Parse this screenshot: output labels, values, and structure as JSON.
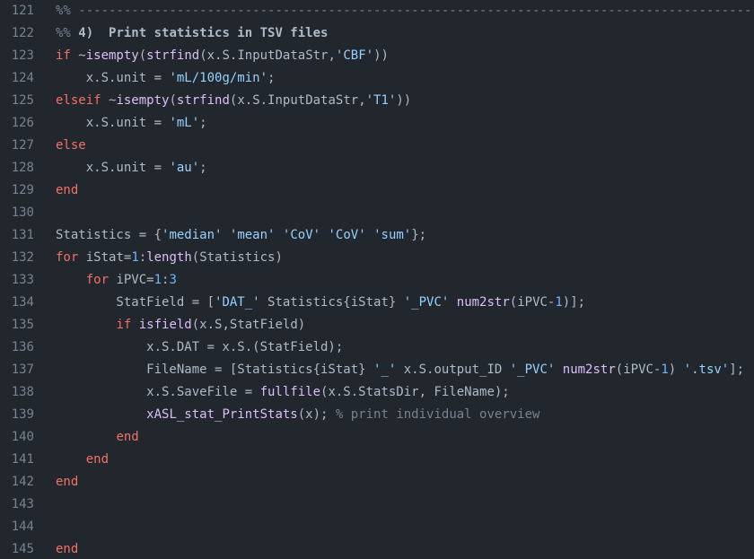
{
  "editor": {
    "lines": [
      {
        "num": "121",
        "tokens": [
          {
            "t": "%% --------------------------------------------------------------------------------------------",
            "c": "com"
          }
        ]
      },
      {
        "num": "122",
        "tokens": [
          {
            "t": "%% ",
            "c": "com"
          },
          {
            "t": "4)  Print statistics in TSV files",
            "c": "hdr"
          }
        ]
      },
      {
        "num": "123",
        "tokens": [
          {
            "t": "if",
            "c": "kw"
          },
          {
            "t": " ~",
            "c": "var"
          },
          {
            "t": "isempty",
            "c": "fn"
          },
          {
            "t": "(",
            "c": "var"
          },
          {
            "t": "strfind",
            "c": "fn"
          },
          {
            "t": "(x.S.InputDataStr,",
            "c": "var"
          },
          {
            "t": "'CBF'",
            "c": "str"
          },
          {
            "t": "))",
            "c": "var"
          }
        ]
      },
      {
        "num": "124",
        "tokens": [
          {
            "t": "    x.S.unit = ",
            "c": "var"
          },
          {
            "t": "'mL/100g/min'",
            "c": "str"
          },
          {
            "t": ";",
            "c": "var"
          }
        ]
      },
      {
        "num": "125",
        "tokens": [
          {
            "t": "elseif",
            "c": "kw"
          },
          {
            "t": " ~",
            "c": "var"
          },
          {
            "t": "isempty",
            "c": "fn"
          },
          {
            "t": "(",
            "c": "var"
          },
          {
            "t": "strfind",
            "c": "fn"
          },
          {
            "t": "(x.S.InputDataStr,",
            "c": "var"
          },
          {
            "t": "'T1'",
            "c": "str"
          },
          {
            "t": "))",
            "c": "var"
          }
        ]
      },
      {
        "num": "126",
        "tokens": [
          {
            "t": "    x.S.unit = ",
            "c": "var"
          },
          {
            "t": "'mL'",
            "c": "str"
          },
          {
            "t": ";",
            "c": "var"
          }
        ]
      },
      {
        "num": "127",
        "tokens": [
          {
            "t": "else",
            "c": "kw"
          }
        ]
      },
      {
        "num": "128",
        "tokens": [
          {
            "t": "    x.S.unit = ",
            "c": "var"
          },
          {
            "t": "'au'",
            "c": "str"
          },
          {
            "t": ";",
            "c": "var"
          }
        ]
      },
      {
        "num": "129",
        "tokens": [
          {
            "t": "end",
            "c": "kw"
          }
        ]
      },
      {
        "num": "130",
        "tokens": []
      },
      {
        "num": "131",
        "tokens": [
          {
            "t": "Statistics = {",
            "c": "var"
          },
          {
            "t": "'median'",
            "c": "str"
          },
          {
            "t": " ",
            "c": "var"
          },
          {
            "t": "'mean'",
            "c": "str"
          },
          {
            "t": " ",
            "c": "var"
          },
          {
            "t": "'CoV'",
            "c": "str"
          },
          {
            "t": " ",
            "c": "var"
          },
          {
            "t": "'CoV'",
            "c": "str"
          },
          {
            "t": " ",
            "c": "var"
          },
          {
            "t": "'sum'",
            "c": "str"
          },
          {
            "t": "};",
            "c": "var"
          }
        ]
      },
      {
        "num": "132",
        "tokens": [
          {
            "t": "for",
            "c": "kw"
          },
          {
            "t": " iStat=",
            "c": "var"
          },
          {
            "t": "1",
            "c": "num"
          },
          {
            "t": ":",
            "c": "var"
          },
          {
            "t": "length",
            "c": "fn"
          },
          {
            "t": "(Statistics)",
            "c": "var"
          }
        ]
      },
      {
        "num": "133",
        "tokens": [
          {
            "t": "    ",
            "c": "var"
          },
          {
            "t": "for",
            "c": "kw"
          },
          {
            "t": " iPVC=",
            "c": "var"
          },
          {
            "t": "1",
            "c": "num"
          },
          {
            "t": ":",
            "c": "var"
          },
          {
            "t": "3",
            "c": "num"
          }
        ]
      },
      {
        "num": "134",
        "tokens": [
          {
            "t": "        StatField = [",
            "c": "var"
          },
          {
            "t": "'DAT_'",
            "c": "str"
          },
          {
            "t": " Statistics{iStat} ",
            "c": "var"
          },
          {
            "t": "'_PVC'",
            "c": "str"
          },
          {
            "t": " ",
            "c": "var"
          },
          {
            "t": "num2str",
            "c": "fn"
          },
          {
            "t": "(iPVC-",
            "c": "var"
          },
          {
            "t": "1",
            "c": "num"
          },
          {
            "t": ")];",
            "c": "var"
          }
        ]
      },
      {
        "num": "135",
        "tokens": [
          {
            "t": "        ",
            "c": "var"
          },
          {
            "t": "if",
            "c": "kw"
          },
          {
            "t": " ",
            "c": "var"
          },
          {
            "t": "isfield",
            "c": "fn"
          },
          {
            "t": "(x.S,StatField)",
            "c": "var"
          }
        ]
      },
      {
        "num": "136",
        "tokens": [
          {
            "t": "            x.S.DAT = x.S.(StatField);",
            "c": "var"
          }
        ]
      },
      {
        "num": "137",
        "tokens": [
          {
            "t": "            FileName = [Statistics{iStat} ",
            "c": "var"
          },
          {
            "t": "'_'",
            "c": "str"
          },
          {
            "t": " x.S.output_ID ",
            "c": "var"
          },
          {
            "t": "'_PVC'",
            "c": "str"
          },
          {
            "t": " ",
            "c": "var"
          },
          {
            "t": "num2str",
            "c": "fn"
          },
          {
            "t": "(iPVC-",
            "c": "var"
          },
          {
            "t": "1",
            "c": "num"
          },
          {
            "t": ") ",
            "c": "var"
          },
          {
            "t": "'.tsv'",
            "c": "str"
          },
          {
            "t": "];",
            "c": "var"
          }
        ]
      },
      {
        "num": "138",
        "tokens": [
          {
            "t": "            x.S.SaveFile = ",
            "c": "var"
          },
          {
            "t": "fullfile",
            "c": "fn"
          },
          {
            "t": "(x.S.StatsDir, FileName);",
            "c": "var"
          }
        ]
      },
      {
        "num": "139",
        "tokens": [
          {
            "t": "            ",
            "c": "var"
          },
          {
            "t": "xASL_stat_PrintStats",
            "c": "fn"
          },
          {
            "t": "(x); ",
            "c": "var"
          },
          {
            "t": "% print individual overview",
            "c": "com"
          }
        ]
      },
      {
        "num": "140",
        "tokens": [
          {
            "t": "        ",
            "c": "var"
          },
          {
            "t": "end",
            "c": "kw"
          }
        ]
      },
      {
        "num": "141",
        "tokens": [
          {
            "t": "    ",
            "c": "var"
          },
          {
            "t": "end",
            "c": "kw"
          }
        ]
      },
      {
        "num": "142",
        "tokens": [
          {
            "t": "end",
            "c": "kw"
          }
        ]
      },
      {
        "num": "143",
        "tokens": []
      },
      {
        "num": "144",
        "tokens": []
      },
      {
        "num": "145",
        "tokens": [
          {
            "t": "end",
            "c": "kw"
          }
        ]
      }
    ]
  }
}
